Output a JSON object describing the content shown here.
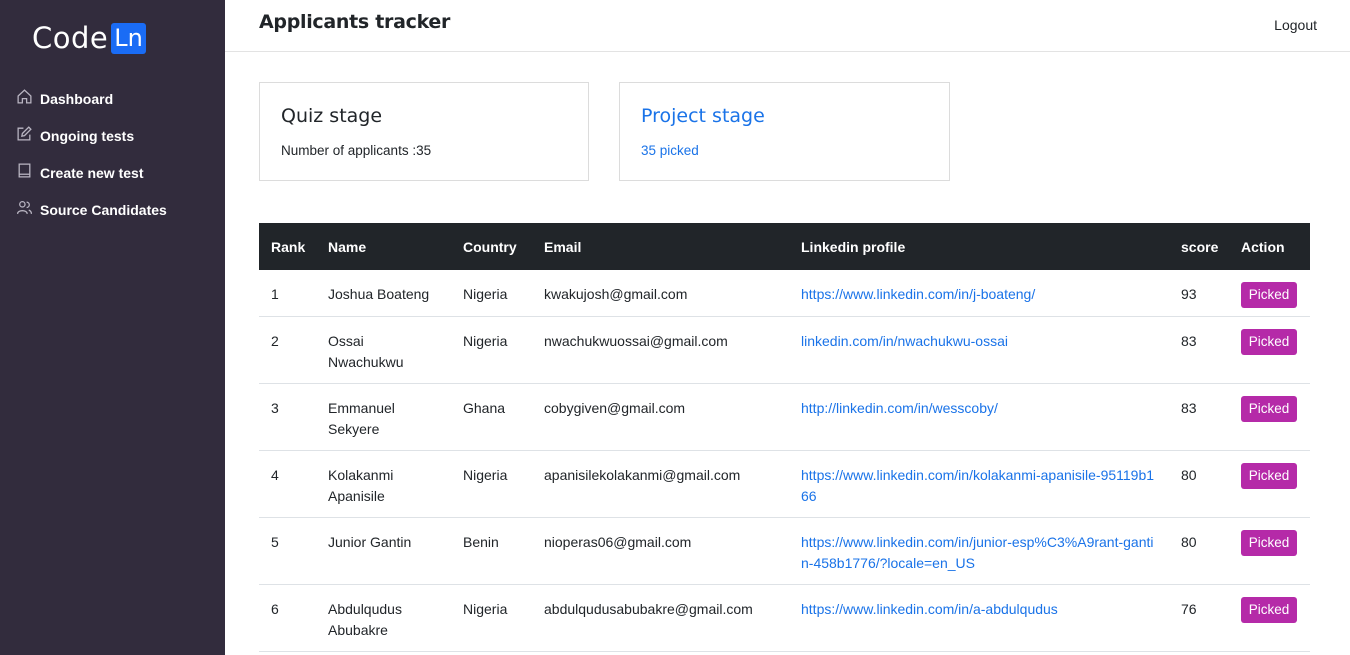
{
  "logo": {
    "code": "Code",
    "ln": "Ln"
  },
  "sidebar": {
    "items": [
      {
        "label": "Dashboard",
        "icon": "home-icon"
      },
      {
        "label": "Ongoing tests",
        "icon": "edit-icon"
      },
      {
        "label": "Create new test",
        "icon": "book-icon"
      },
      {
        "label": "Source Candidates",
        "icon": "users-icon"
      }
    ]
  },
  "header": {
    "title": "Applicants tracker",
    "logout": "Logout"
  },
  "cards": {
    "quiz": {
      "title": "Quiz stage",
      "text": "Number of applicants :35"
    },
    "project": {
      "title": "Project stage",
      "text": "35 picked"
    }
  },
  "table": {
    "headers": [
      "Rank",
      "Name",
      "Country",
      "Email",
      "Linkedin profile",
      "score",
      "Action"
    ],
    "rows": [
      {
        "rank": "1",
        "name": "Joshua Boateng",
        "country": "Nigeria",
        "email": "kwakujosh@gmail.com",
        "linkedin": "https://www.linkedin.com/in/j-boateng/",
        "score": "93",
        "action": "Picked"
      },
      {
        "rank": "2",
        "name": "Ossai Nwachukwu",
        "country": "Nigeria",
        "email": "nwachukwuossai@gmail.com",
        "linkedin": "linkedin.com/in/nwachukwu-ossai",
        "score": "83",
        "action": "Picked"
      },
      {
        "rank": "3",
        "name": "Emmanuel Sekyere",
        "country": "Ghana",
        "email": "cobygiven@gmail.com",
        "linkedin": "http://linkedin.com/in/wesscoby/",
        "score": "83",
        "action": "Picked"
      },
      {
        "rank": "4",
        "name": "Kolakanmi Apanisile",
        "country": "Nigeria",
        "email": "apanisilekolakanmi@gmail.com",
        "linkedin": "https://www.linkedin.com/in/kolakanmi-apanisile-95119b166",
        "score": "80",
        "action": "Picked"
      },
      {
        "rank": "5",
        "name": "Junior Gantin",
        "country": "Benin",
        "email": "nioperas06@gmail.com",
        "linkedin": "https://www.linkedin.com/in/junior-esp%C3%A9rant-gantin-458b1776/?locale=en_US",
        "score": "80",
        "action": "Picked"
      },
      {
        "rank": "6",
        "name": "Abdulqudus Abubakre",
        "country": "Nigeria",
        "email": "abdulqudusabubakre@gmail.com",
        "linkedin": "https://www.linkedin.com/in/a-abdulqudus",
        "score": "76",
        "action": "Picked"
      }
    ]
  },
  "colors": {
    "sidebar": "#322c3d",
    "accent": "#1a6cf5",
    "picked": "#b52aa8",
    "link": "#1a73e8",
    "table_header": "#212529"
  }
}
